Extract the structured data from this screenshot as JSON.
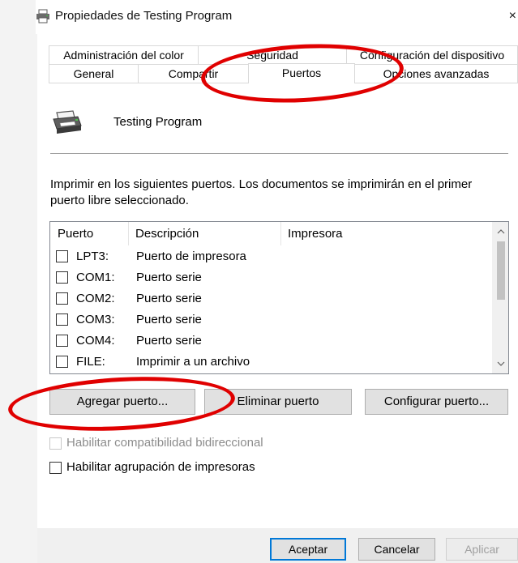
{
  "window": {
    "title": "Propiedades de Testing Program",
    "close_glyph": "×",
    "icon": "printer-icon"
  },
  "tabs": {
    "row1": [
      {
        "label": "Administración del color"
      },
      {
        "label": "Seguridad"
      },
      {
        "label": "Configuración del dispositivo"
      }
    ],
    "row2": [
      {
        "label": "General"
      },
      {
        "label": "Compartir"
      },
      {
        "label": "Puertos",
        "active": true
      },
      {
        "label": "Opciones avanzadas"
      }
    ]
  },
  "panel": {
    "printer_name": "Testing Program",
    "description": "Imprimir en los siguientes puertos. Los documentos se imprimirán en el primer puerto libre seleccionado."
  },
  "ports": {
    "columns": [
      "Puerto",
      "Descripción",
      "Impresora"
    ],
    "rows": [
      {
        "port": "LPT3:",
        "description": "Puerto de impresora",
        "printer": "",
        "checked": false
      },
      {
        "port": "COM1:",
        "description": "Puerto serie",
        "printer": "",
        "checked": false
      },
      {
        "port": "COM2:",
        "description": "Puerto serie",
        "printer": "",
        "checked": false
      },
      {
        "port": "COM3:",
        "description": "Puerto serie",
        "printer": "",
        "checked": false
      },
      {
        "port": "COM4:",
        "description": "Puerto serie",
        "printer": "",
        "checked": false
      },
      {
        "port": "FILE:",
        "description": "Imprimir a un archivo",
        "printer": "",
        "checked": false
      }
    ],
    "scroll_up_glyph": "︿",
    "scroll_down_glyph": "﹀"
  },
  "buttons": {
    "add_port": "Agregar puerto...",
    "delete_port": "Eliminar puerto",
    "configure_port": "Configurar puerto..."
  },
  "options": {
    "bidirectional": {
      "label": "Habilitar compatibilidad bidireccional",
      "checked": false,
      "enabled": false
    },
    "pooling": {
      "label": "Habilitar agrupación de impresoras",
      "checked": false,
      "enabled": true
    }
  },
  "footer": {
    "ok": "Aceptar",
    "cancel": "Cancelar",
    "apply": "Aplicar"
  },
  "colors": {
    "annotation": "#e00000",
    "focus_border": "#0078d7",
    "disabled_text": "#8c8c8c"
  }
}
